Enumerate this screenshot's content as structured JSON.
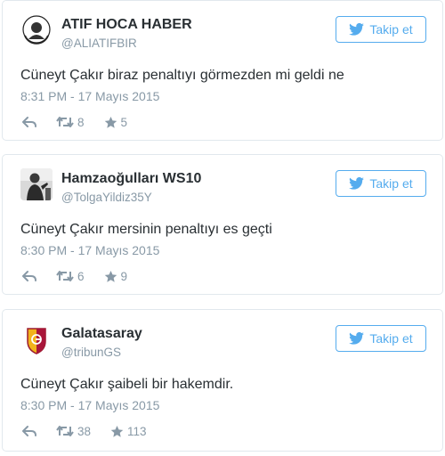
{
  "colors": {
    "accent": "#55acee",
    "text": "#292f33",
    "muted": "#8899a6",
    "border": "#e1e8ed"
  },
  "tweets": [
    {
      "name": "ATIF HOCA HABER",
      "handle": "@ALIATIFBIR",
      "avatar_icon": "atif-hoca-avatar",
      "follow_label": "Takip et",
      "text": "Cüneyt Çakır biraz penaltıyı görmezden mi geldi ne",
      "timestamp": "8:31 PM - 17 Mayıs 2015",
      "retweets": "8",
      "favorites": "5"
    },
    {
      "name": "Hamzaoğulları WS10",
      "handle": "@TolgaYildiz35Y",
      "avatar_icon": "person-avatar",
      "follow_label": "Takip et",
      "text": "Cüneyt Çakır mersinin penaltıyı es geçti",
      "timestamp": "8:30 PM - 17 Mayıs 2015",
      "retweets": "6",
      "favorites": "9"
    },
    {
      "name": "Galatasaray",
      "handle": "@tribunGS",
      "avatar_icon": "galatasaray-logo",
      "follow_label": "Takip et",
      "text": "Cüneyt Çakır şaibeli bir hakemdir.",
      "timestamp": "8:30 PM - 17 Mayıs 2015",
      "retweets": "38",
      "favorites": "113"
    }
  ]
}
